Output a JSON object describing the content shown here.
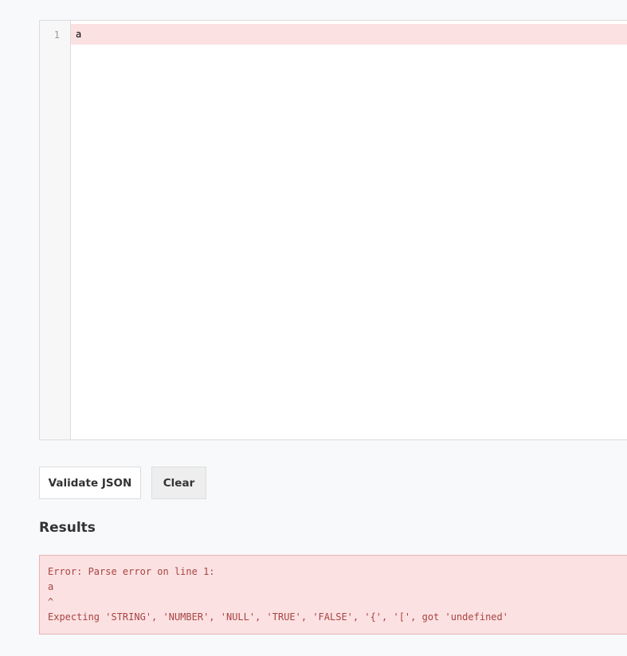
{
  "editor": {
    "line_number": "1",
    "content": "a"
  },
  "buttons": {
    "validate_label": "Validate JSON",
    "clear_label": "Clear"
  },
  "results": {
    "heading": "Results",
    "error_lines": [
      "Error: Parse error on line 1:",
      "a",
      "^",
      "Expecting 'STRING', 'NUMBER', 'NULL', 'TRUE', 'FALSE', '{', '[', got 'undefined'"
    ]
  },
  "colors": {
    "error_background": "#fbe1e2",
    "error_text": "#a94442"
  }
}
